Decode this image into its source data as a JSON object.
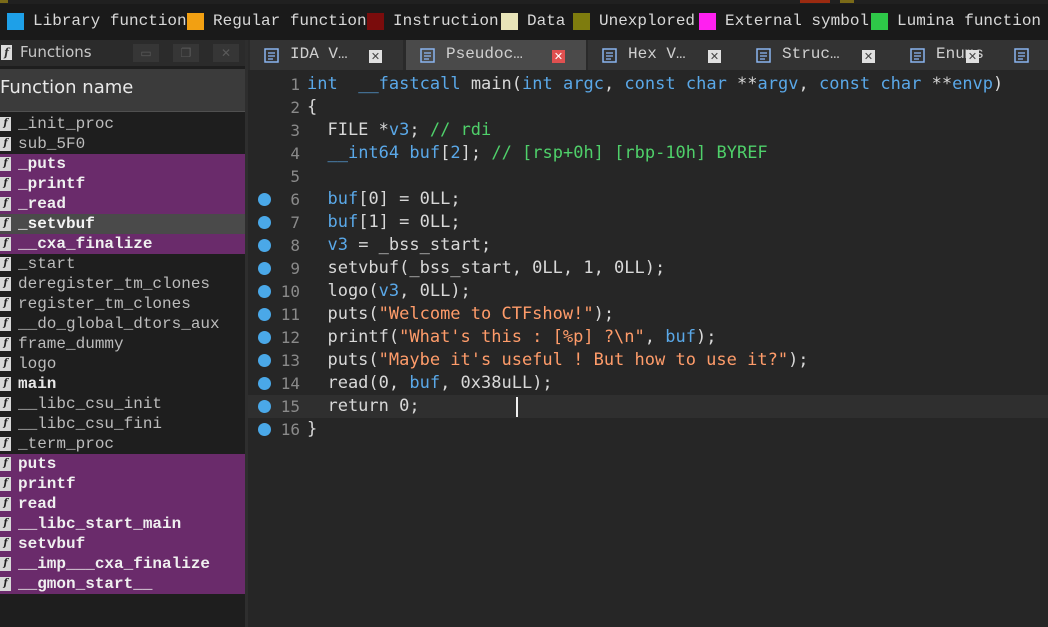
{
  "legend": [
    {
      "label": "Library function",
      "color": "#1ea0e8"
    },
    {
      "label": "Regular function",
      "color": "#f2a012"
    },
    {
      "label": "Instruction",
      "color": "#7a0c0c"
    },
    {
      "label": "Data",
      "color": "#e8e4b8"
    },
    {
      "label": "Unexplored",
      "color": "#7e7c0e"
    },
    {
      "label": "External symbol",
      "color": "#ff20f0"
    },
    {
      "label": "Lumina function",
      "color": "#2ec848"
    }
  ],
  "functions_panel": {
    "title": "Functions",
    "column_header": "Function name",
    "items": [
      {
        "name": "_init_proc",
        "style": "normal"
      },
      {
        "name": "sub_5F0",
        "style": "normal"
      },
      {
        "name": "_puts",
        "style": "plt"
      },
      {
        "name": "_printf",
        "style": "plt"
      },
      {
        "name": "_read",
        "style": "plt"
      },
      {
        "name": "_setvbuf",
        "style": "sel"
      },
      {
        "name": "__cxa_finalize",
        "style": "plt"
      },
      {
        "name": "_start",
        "style": "normal"
      },
      {
        "name": "deregister_tm_clones",
        "style": "normal"
      },
      {
        "name": "register_tm_clones",
        "style": "normal"
      },
      {
        "name": "__do_global_dtors_aux",
        "style": "normal"
      },
      {
        "name": "frame_dummy",
        "style": "normal"
      },
      {
        "name": "logo",
        "style": "normal"
      },
      {
        "name": "main",
        "style": "bold"
      },
      {
        "name": "__libc_csu_init",
        "style": "normal"
      },
      {
        "name": "__libc_csu_fini",
        "style": "normal"
      },
      {
        "name": "_term_proc",
        "style": "normal"
      },
      {
        "name": "puts",
        "style": "plt"
      },
      {
        "name": "printf",
        "style": "plt"
      },
      {
        "name": "read",
        "style": "plt"
      },
      {
        "name": "__libc_start_main",
        "style": "plt"
      },
      {
        "name": "setvbuf",
        "style": "plt"
      },
      {
        "name": "__imp___cxa_finalize",
        "style": "plt"
      },
      {
        "name": "__gmon_start__",
        "style": "plt"
      }
    ]
  },
  "tabs": [
    {
      "label": "IDA V…",
      "icon": "ida-view-icon",
      "active": false
    },
    {
      "label": "Pseudoc…",
      "icon": "pseudocode-icon",
      "active": true
    },
    {
      "label": "Hex V…",
      "icon": "hex-view-icon",
      "active": false
    },
    {
      "label": "Struc…",
      "icon": "structures-icon",
      "active": false
    },
    {
      "label": "Enums",
      "icon": "enums-icon",
      "active": false
    },
    {
      "label": "",
      "icon": "imports-icon",
      "active": false
    }
  ],
  "code": {
    "current_line": 15,
    "lines": [
      {
        "n": "1",
        "bp": false,
        "segs": [
          [
            "ty",
            "int"
          ],
          [
            "",
            "  "
          ],
          [
            "kw",
            "__fastcall"
          ],
          [
            "",
            " "
          ],
          [
            "fn",
            "main"
          ],
          [
            "",
            "("
          ],
          [
            "ty",
            "int"
          ],
          [
            "",
            " "
          ],
          [
            "kw",
            "argc"
          ],
          [
            "",
            ", "
          ],
          [
            "ty",
            "const"
          ],
          [
            "",
            " "
          ],
          [
            "ty",
            "char"
          ],
          [
            "",
            " **"
          ],
          [
            "kw",
            "argv"
          ],
          [
            "",
            ", "
          ],
          [
            "ty",
            "const"
          ],
          [
            "",
            " "
          ],
          [
            "ty",
            "char"
          ],
          [
            "",
            " **"
          ],
          [
            "kw",
            "envp"
          ],
          [
            "",
            ")"
          ]
        ]
      },
      {
        "n": "2",
        "bp": false,
        "segs": [
          [
            "",
            "{"
          ]
        ]
      },
      {
        "n": "3",
        "bp": false,
        "segs": [
          [
            "",
            "  FILE *"
          ],
          [
            "kw",
            "v3"
          ],
          [
            "",
            "; "
          ],
          [
            "cm",
            "// rdi"
          ]
        ]
      },
      {
        "n": "4",
        "bp": false,
        "segs": [
          [
            "",
            "  "
          ],
          [
            "ty",
            "__int64"
          ],
          [
            "",
            " "
          ],
          [
            "kw",
            "buf"
          ],
          [
            "",
            "["
          ],
          [
            "kw",
            "2"
          ],
          [
            "",
            "]; "
          ],
          [
            "cm",
            "// [rsp+0h] [rbp-10h] BYREF"
          ]
        ]
      },
      {
        "n": "5",
        "bp": false,
        "segs": [
          [
            "",
            ""
          ]
        ]
      },
      {
        "n": "6",
        "bp": true,
        "segs": [
          [
            "",
            "  "
          ],
          [
            "kw",
            "buf"
          ],
          [
            "",
            "[0] = 0LL;"
          ]
        ]
      },
      {
        "n": "7",
        "bp": true,
        "segs": [
          [
            "",
            "  "
          ],
          [
            "kw",
            "buf"
          ],
          [
            "",
            "[1] = 0LL;"
          ]
        ]
      },
      {
        "n": "8",
        "bp": true,
        "segs": [
          [
            "",
            "  "
          ],
          [
            "kw",
            "v3"
          ],
          [
            "",
            " = _bss_start;"
          ]
        ]
      },
      {
        "n": "9",
        "bp": true,
        "segs": [
          [
            "",
            "  setvbuf(_bss_start, 0LL, 1, 0LL);"
          ]
        ]
      },
      {
        "n": "10",
        "bp": true,
        "segs": [
          [
            "",
            "  logo("
          ],
          [
            "kw",
            "v3"
          ],
          [
            "",
            ", 0LL);"
          ]
        ]
      },
      {
        "n": "11",
        "bp": true,
        "segs": [
          [
            "",
            "  puts("
          ],
          [
            "str",
            "\"Welcome to CTFshow!\""
          ],
          [
            "",
            ");"
          ]
        ]
      },
      {
        "n": "12",
        "bp": true,
        "segs": [
          [
            "",
            "  printf("
          ],
          [
            "str",
            "\"What's this : [%p] ?\\n\""
          ],
          [
            "",
            ", "
          ],
          [
            "kw",
            "buf"
          ],
          [
            "",
            ");"
          ]
        ]
      },
      {
        "n": "13",
        "bp": true,
        "segs": [
          [
            "",
            "  puts("
          ],
          [
            "str",
            "\"Maybe it's useful ! But how to use it?\""
          ],
          [
            "",
            ");"
          ]
        ]
      },
      {
        "n": "14",
        "bp": true,
        "segs": [
          [
            "",
            "  read(0, "
          ],
          [
            "kw",
            "buf"
          ],
          [
            "",
            ", 0x38uLL);"
          ]
        ]
      },
      {
        "n": "15",
        "bp": true,
        "segs": [
          [
            "",
            "  return 0;"
          ]
        ]
      },
      {
        "n": "16",
        "bp": true,
        "segs": [
          [
            "",
            "}"
          ]
        ]
      }
    ]
  }
}
